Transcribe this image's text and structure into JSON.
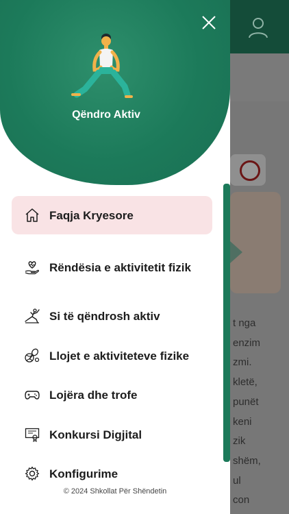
{
  "background": {
    "text_lines": [
      "t nga",
      "enzim",
      "zmi.",
      "kletë,",
      "punët",
      "keni",
      "zik",
      "shëm,",
      "ul",
      "con"
    ]
  },
  "drawer": {
    "app_title": "Qëndro Aktiv",
    "menu": [
      {
        "label": "Faqja Kryesore",
        "icon": "home-icon",
        "active": true
      },
      {
        "label": "Rëndësia e aktivitetit fizik",
        "icon": "heart-hand-icon",
        "active": false
      },
      {
        "label": "Si të qëndrosh aktiv",
        "icon": "stretching-icon",
        "active": false
      },
      {
        "label": "Llojet e aktiviteteve fizike",
        "icon": "sports-icon",
        "active": false
      },
      {
        "label": "Lojëra dhe trofe",
        "icon": "gamepad-icon",
        "active": false
      },
      {
        "label": "Konkursi Digjital",
        "icon": "certificate-icon",
        "active": false
      },
      {
        "label": "Konfigurime",
        "icon": "settings-icon",
        "active": false
      }
    ],
    "copyright": "© 2024 Shkollat Për Shëndetin"
  },
  "colors": {
    "brand_green": "#1c7a5a",
    "active_item_bg": "#f9e3e5"
  }
}
